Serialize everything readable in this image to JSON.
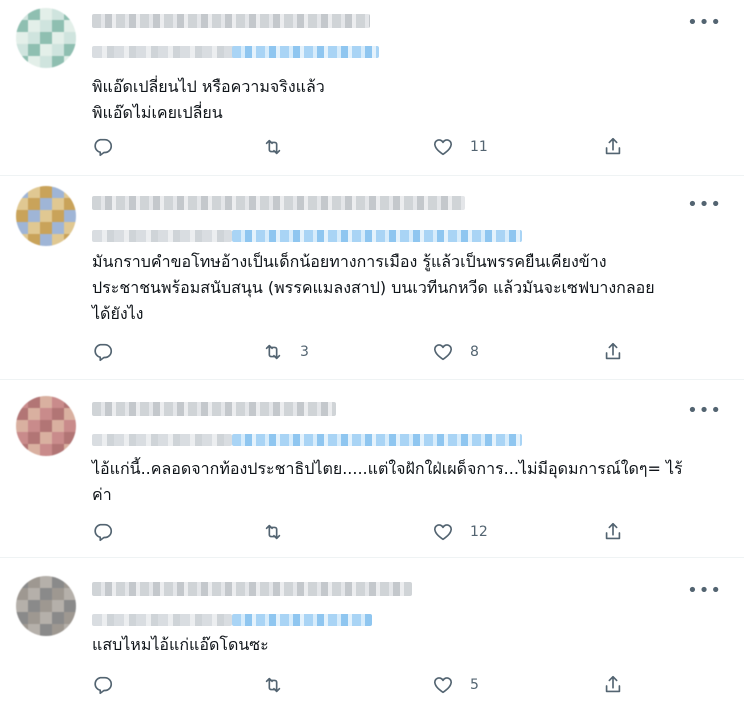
{
  "replies": [
    {
      "text": "พิแอ๊ดเปลี่ยนไป หรือความจริงแล้ว\nพิแอ๊ดไม่เคยเปลี่ยน",
      "reply_count": "",
      "retweet_count": "",
      "like_count": "11",
      "avatar_colors": [
        "#cfe4de",
        "#a8cfc4",
        "#e3efe9",
        "#b5d6cc",
        "#8fbfb1",
        "#d9ebe5"
      ]
    },
    {
      "text": "มันกราบคำขอโทษอ้างเป็นเด็กน้อยทางการเมือง รู้แล้วเป็นพรรคยืนเคียงข้าง\nประชาชนพร้อมสนับสนุน (พรรคแมลงสาป) บนเวทีนกหวีด แล้วมันจะเซฟบางกลอย\nได้ยังไง",
      "reply_count": "",
      "retweet_count": "3",
      "like_count": "8",
      "avatar_colors": [
        "#9fb5d6",
        "#7a8fb0",
        "#c9a35a",
        "#b88a3c",
        "#e0c892",
        "#5d6f8c"
      ]
    },
    {
      "text": "ไอ้แก่นี้..คลอดจากท้องประชาธิปไตย.....แต่ใจฝักใฝ่เผด็จการ...ไม่มีอุดมการณ์ใดๆ= ไร้\nค่า",
      "reply_count": "",
      "retweet_count": "",
      "like_count": "12",
      "avatar_colors": [
        "#c98b8b",
        "#a86a6a",
        "#d9b0a0",
        "#8a9a7a",
        "#b27575",
        "#e2c6bd"
      ]
    },
    {
      "text": "แสบไหมไอ้แก่แอ๊ดโดนซะ",
      "reply_count": "",
      "retweet_count": "",
      "like_count": "5",
      "avatar_colors": [
        "#8a8a8a",
        "#6b6b6b",
        "#b5b0aa",
        "#5a5a5a",
        "#9e9891",
        "#c7c2bc"
      ]
    }
  ],
  "icons": {
    "reply": "reply-icon",
    "retweet": "retweet-icon",
    "like": "heart-icon",
    "share": "share-icon",
    "more": "more-icon"
  },
  "colors": {
    "icon": "#536471",
    "text": "#0f1419",
    "divider": "#eff3f4",
    "link_blur": "#a9d4f5"
  }
}
